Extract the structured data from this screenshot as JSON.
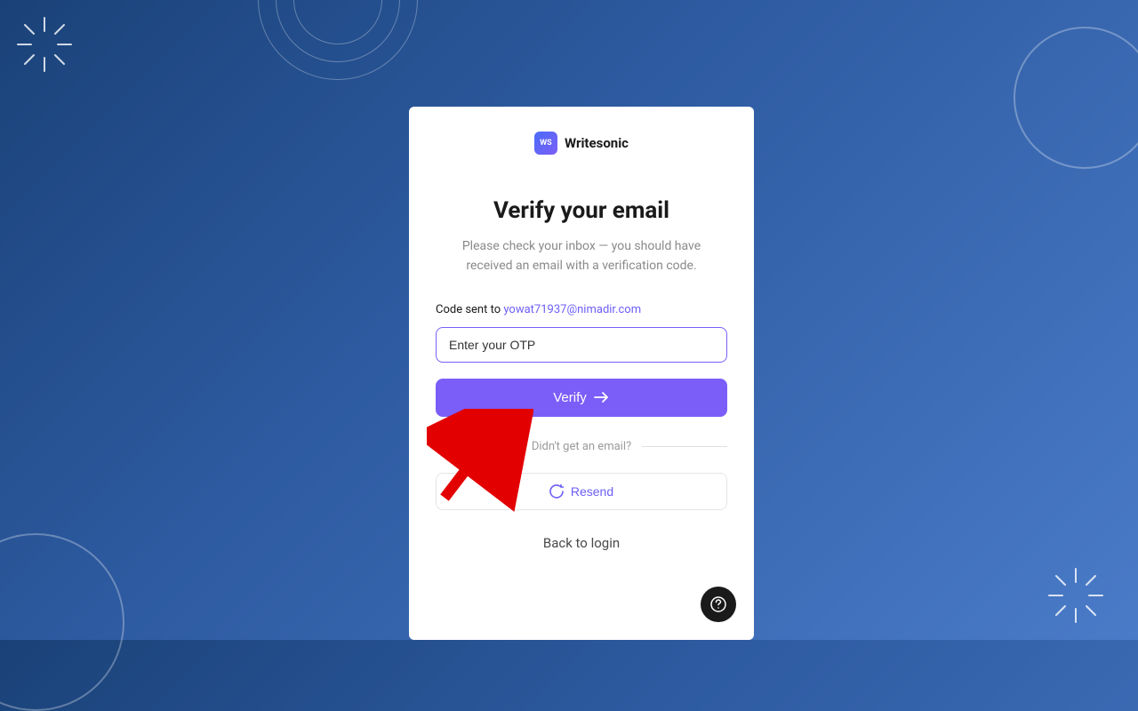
{
  "brand": {
    "name": "Writesonic",
    "logoAbbrev": "WS"
  },
  "heading": "Verify your email",
  "subheading": "Please check your inbox — you should have received an email with a verification code.",
  "codeSent": {
    "prefix": "Code sent to ",
    "email": "yowat71937@nimadir.com"
  },
  "otp": {
    "placeholder": "Enter your OTP"
  },
  "buttons": {
    "verify": "Verify",
    "resend": "Resend",
    "back": "Back to login"
  },
  "divider": "Didn't get an email?",
  "colors": {
    "accent": "#7b5ef7",
    "link": "#6d5ef7"
  }
}
